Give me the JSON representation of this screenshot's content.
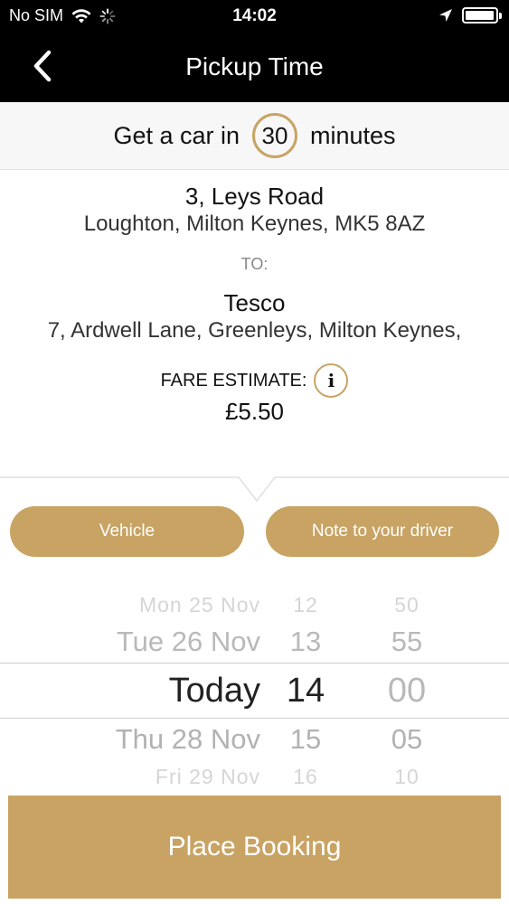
{
  "status_bar": {
    "carrier": "No SIM",
    "time": "14:02",
    "wifi_icon": "wifi-icon",
    "activity_icon": "activity-spinner-icon",
    "location_icon": "location-arrow-icon",
    "battery_icon": "battery-icon"
  },
  "nav": {
    "back_icon": "chevron-left-icon",
    "title": "Pickup Time"
  },
  "eta": {
    "prefix": "Get a car in",
    "minutes": "30",
    "suffix": "minutes"
  },
  "trip": {
    "pickup_name": "3, Leys Road",
    "pickup_address": "Loughton, Milton Keynes, MK5 8AZ",
    "to_label": "TO:",
    "destination_name": "Tesco",
    "destination_address": "7, Ardwell Lane, Greenleys, Milton Keynes,",
    "fare_label": "FARE ESTIMATE:",
    "fare_info_icon": "info-icon",
    "fare_value": "£5.50"
  },
  "options": {
    "vehicle_label": "Vehicle",
    "note_label": "Note to your driver"
  },
  "picker": {
    "rows": [
      {
        "day": "Mon 25 Nov",
        "hour": "12",
        "minute": "50"
      },
      {
        "day": "Tue 26 Nov",
        "hour": "13",
        "minute": "55"
      },
      {
        "day": "Today",
        "hour": "14",
        "minute": "00"
      },
      {
        "day": "Thu 28 Nov",
        "hour": "15",
        "minute": "05"
      },
      {
        "day": "Fri 29 Nov",
        "hour": "16",
        "minute": "10"
      }
    ]
  },
  "booking": {
    "place_label": "Place Booking"
  },
  "colors": {
    "accent": "#c8a363",
    "header_bg": "#000000"
  }
}
